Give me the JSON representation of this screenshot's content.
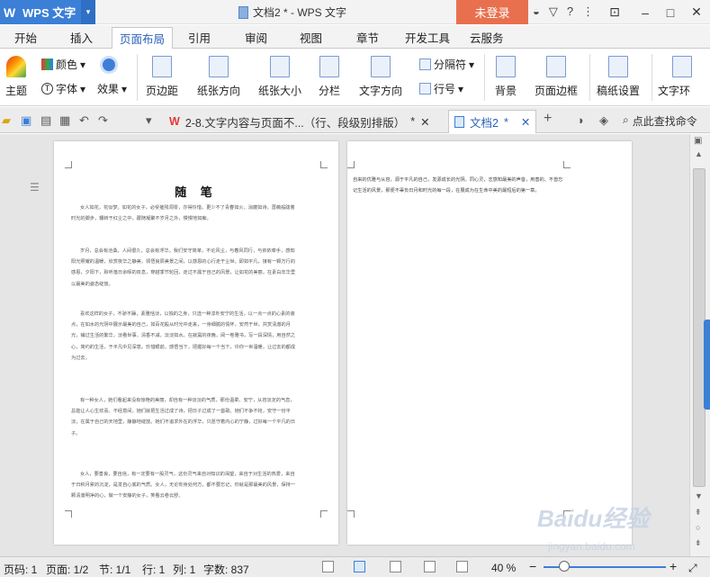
{
  "app": {
    "name": "WPS 文字",
    "login": "未登录"
  },
  "window": {
    "title": "文档2 * - WPS 文字",
    "help": "?"
  },
  "menu": [
    "开始",
    "插入",
    "页面布局",
    "引用",
    "审阅",
    "视图",
    "章节",
    "开发工具",
    "云服务"
  ],
  "menu_active": "页面布局",
  "ribbon": {
    "color": "颜色",
    "theme": "主题",
    "font": "字体",
    "effect": "效果",
    "margins": "页边距",
    "orientation": "纸张方向",
    "size": "纸张大小",
    "columns": "分栏",
    "direction": "文字方向",
    "separator": "分隔符",
    "line_number": "行号",
    "background": "背景",
    "border": "页面边框",
    "manuscript": "稿纸设置",
    "wrap": "文字环"
  },
  "tabs": [
    {
      "label": "2-8.文字内容与页面不...（行、段级别排版）",
      "modified": "*"
    },
    {
      "label": "文档2",
      "modified": "*"
    }
  ],
  "search_placeholder": "点此查找命令",
  "doc": {
    "title": "随 笔",
    "paragraphs": [
      "女人如花，花似梦。如花的女子，必受摧残凋零，亦得怜惜，更少不了青春如火，消磨如诗，蔷薇般跋着时光的脚步，辗转于红尘之中，跟随凝聚不岁月之外，慢慢地如痴。",
      "岁月，总会有沧桑，人间很久，总会有浮华。我们安守简单，不论风尘，与春风同行，与依依牵手，感知阳光照耀的温暖，欣赏夜华之静美，领悟良辰美景之间，以感恩的心行走于尘世。即如平凡，接有一颗万行的感恩，夕阳下，聆听落日余晖的叹息，穿越季节轮回，走过不属于自己的风景，让如花的美丽，在素白年华里以最美的姿态绽放。",
      "喜欢这样的女子，不骄不躁，素雅恬淡，以独的之身，只选一种淳朴安宁的生活，以一点一点的心素的装点，在如水的光阴中展示最美的自己，如百花般从时光中走来，一身细腻的情怀，安然于世，共赏清澈的月光，铺过生活的繁华，淡看世事，清香不减，淡淡如水。在寂寞的夜晚，阅一卷雅书，写一段深情，用自然之心，简约的生活，于平凡中见深意。珍惜眼前，感悟当下，把握好每一个当下，许你一世温暖，让过去的都成为过去。",
      "有一种女人，她们看起来没有惊艳的美丽，却自有一种淡淡的气质，那份温柔、安宁，从容淡定的气息，总能让人心生欢喜。不经意间，她们就把生活过成了诗，把日子过成了一首歌。她们不争不抢，安守一份平淡，在属于自己的天地里，静静地绽放。她们不追求外在的浮华，只愿守着内心的宁静，过好每一个平凡的日子。",
      "女人，要善良，要自信，有一定要有一股灵气，这份灵气来自对知识的渴望，来自于对生活的热爱，来自于日积月累的沉淀，是发自心底的气质。女人，无论你身处何方，都不要忘记，你就是那最美的风景，保持一颗清澈明净的心，做一个安静的女子，笑看云卷云舒。"
    ],
    "page2": "自来的优雅与从容，源于平凡的自己，发源成长的光阴。同心灵，志感知最美的声音，用善的、不曾忘记生活的风景，那便不辜负日月和时光的每一段，在展成为在生命中美的最短后的第一章。"
  },
  "status": {
    "page_code": "页码: 1",
    "page": "页面: 1/2",
    "section": "节: 1/1",
    "row": "行: 1",
    "col": "列: 1",
    "words": "字数: 837",
    "zoom": "40 %"
  },
  "watermark": {
    "brand": "Baidu经验",
    "url": "jingyan.baidu.com"
  }
}
